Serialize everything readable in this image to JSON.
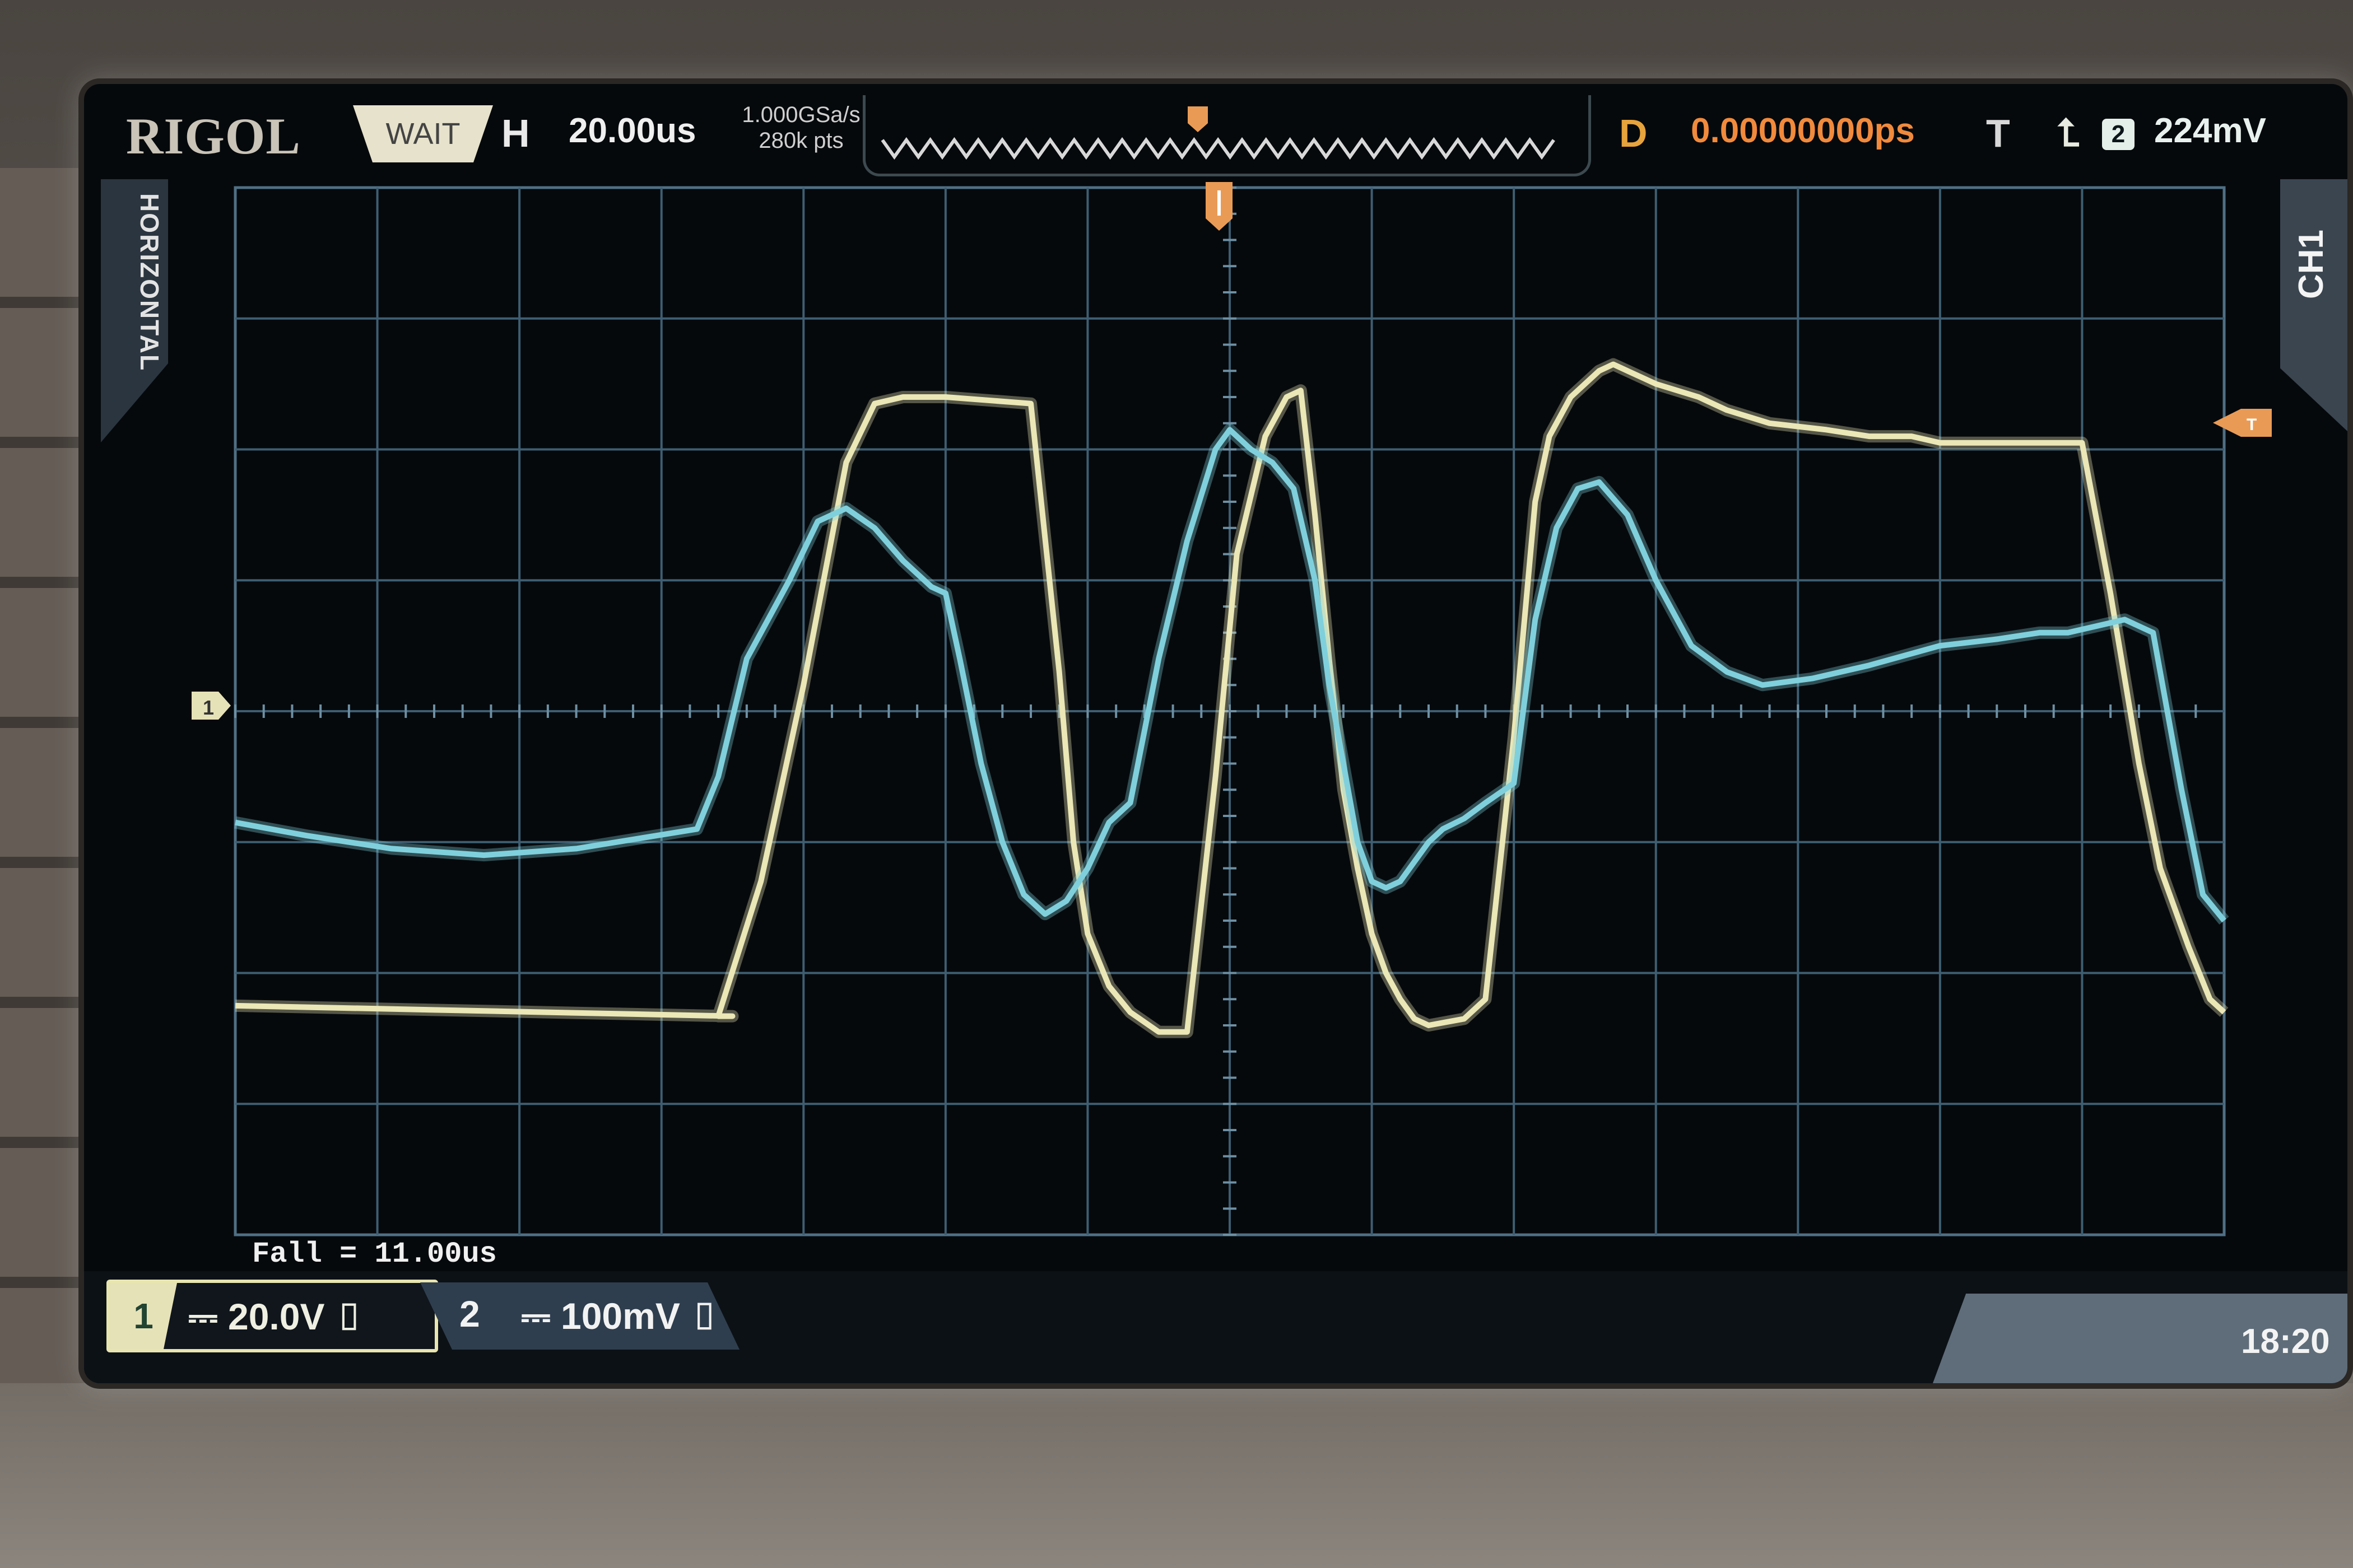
{
  "brand": "RIGOL",
  "status": "WAIT",
  "horizontal": {
    "label": "H",
    "timebase": "20.00us",
    "sample_rate": "1.000GSa/s",
    "memory_depth": "280k pts"
  },
  "delay": {
    "label": "D",
    "value": "0.00000000ps"
  },
  "trigger": {
    "label": "T",
    "edge_icon": "rising-edge-icon",
    "source": "2",
    "level": "224mV"
  },
  "side_tabs": {
    "left": "HORIZONTAL",
    "right": "CH1"
  },
  "measurement": "Fall = 11.00us",
  "channels": [
    {
      "number": "1",
      "coupling_icon": "dc-coupling-icon",
      "scale": "20.0V",
      "color": "#ebe7b6"
    },
    {
      "number": "2",
      "coupling_icon": "dc-coupling-icon",
      "scale": "100mV",
      "color": "#7fd0dc"
    }
  ],
  "clock": "18:20",
  "chart_data": {
    "type": "line",
    "grid": true,
    "xlim": [
      -140,
      140
    ],
    "xlabel": "",
    "ylabel": "",
    "series": [
      {
        "color": "#ebe7b6",
        "x": [
          -140,
          -70,
          -72,
          -66,
          -60,
          -54,
          -50,
          -46,
          -42,
          -40,
          -28,
          -24,
          -22,
          -20,
          -17,
          -14,
          -10,
          -6,
          -2,
          1,
          5,
          8,
          10,
          12,
          14,
          16,
          18,
          20,
          22,
          24,
          26,
          28,
          33,
          36,
          40,
          43,
          45,
          48,
          52,
          54,
          56,
          60,
          66,
          70,
          76,
          84,
          90,
          96,
          100,
          104,
          110,
          120,
          124,
          128,
          131,
          135,
          138,
          140
        ],
        "y": [
          -2.25,
          -2.33,
          -2.33,
          -1.3,
          0.2,
          1.9,
          2.35,
          2.4,
          2.4,
          2.4,
          2.35,
          0.3,
          -1.0,
          -1.7,
          -2.1,
          -2.3,
          -2.45,
          -2.45,
          -0.5,
          1.2,
          2.1,
          2.4,
          2.45,
          1.5,
          0.4,
          -0.6,
          -1.2,
          -1.7,
          -2.0,
          -2.2,
          -2.35,
          -2.4,
          -2.35,
          -2.2,
          -0.2,
          1.6,
          2.1,
          2.4,
          2.6,
          2.65,
          2.6,
          2.5,
          2.4,
          2.3,
          2.2,
          2.15,
          2.1,
          2.1,
          2.05,
          2.05,
          2.05,
          2.05,
          0.9,
          -0.4,
          -1.2,
          -1.8,
          -2.2,
          -2.3
        ]
      },
      {
        "color": "#7fd0dc",
        "x": [
          -140,
          -130,
          -118,
          -105,
          -92,
          -75,
          -72,
          -68,
          -62,
          -58,
          -54,
          -50,
          -46,
          -42,
          -40,
          -38,
          -35,
          -32,
          -29,
          -26,
          -23,
          -20,
          -17,
          -14,
          -10,
          -6,
          -2,
          0,
          3,
          6,
          9,
          12,
          14,
          16,
          18,
          20,
          22,
          24,
          26,
          28,
          30,
          33,
          36,
          40,
          43,
          46,
          49,
          52,
          56,
          60,
          65,
          70,
          75,
          82,
          90,
          100,
          108,
          114,
          118,
          122,
          126,
          130,
          134,
          137,
          140
        ],
        "y": [
          -0.85,
          -0.95,
          -1.05,
          -1.1,
          -1.05,
          -0.9,
          -0.5,
          0.4,
          1.0,
          1.45,
          1.55,
          1.4,
          1.15,
          0.95,
          0.9,
          0.4,
          -0.4,
          -1.0,
          -1.4,
          -1.55,
          -1.45,
          -1.2,
          -0.85,
          -0.7,
          0.4,
          1.3,
          2.0,
          2.15,
          2.0,
          1.9,
          1.7,
          1.0,
          0.2,
          -0.4,
          -1.0,
          -1.3,
          -1.35,
          -1.3,
          -1.15,
          -1.0,
          -0.9,
          -0.82,
          -0.7,
          -0.55,
          0.7,
          1.4,
          1.7,
          1.75,
          1.5,
          1.0,
          0.5,
          0.3,
          0.2,
          0.25,
          0.35,
          0.5,
          0.55,
          0.6,
          0.6,
          0.65,
          0.7,
          0.6,
          -0.6,
          -1.4,
          -1.6
        ]
      }
    ]
  }
}
